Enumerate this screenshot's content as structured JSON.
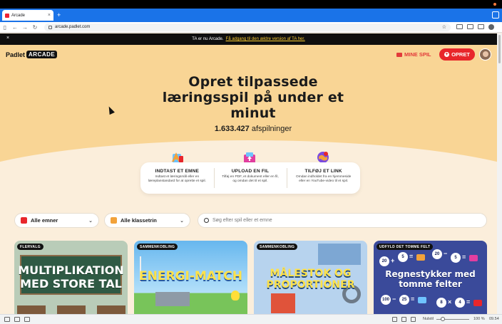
{
  "browser": {
    "tab_title": "Arcade",
    "tab_close": "×",
    "new_tab": "+",
    "url": "arcade.padlet.com",
    "bookmark": "☆"
  },
  "announcement": {
    "close": "×",
    "text": "TA er nu Arcade.",
    "link": "Få adgang til den ældre version af TA her."
  },
  "nav": {
    "logo_text": "Padlet",
    "logo_badge": "ARCADE",
    "my_games": "MINE SPIL",
    "create": "OPRET",
    "create_plus": "+"
  },
  "hero": {
    "title": "Opret tilpassede læringsspil på under et minut",
    "count_value": "1.633.427",
    "count_label": "afspilninger"
  },
  "steps": [
    {
      "title": "INDTAST ET EMNE",
      "desc": "Indtast et læringsmål eller en læreplanstandard for at oprette et spil."
    },
    {
      "title": "UPLOAD EN FIL",
      "desc": "Tilføj en PDF, et dokument eller en fil, og omdan det til et spil."
    },
    {
      "title": "TILFØJ ET LINK",
      "desc": "Omdan indholdet fra en hjemmeside eller en YouTube-video til et spil."
    }
  ],
  "filters": {
    "subjects": "Alle emner",
    "grades": "Alle klassetrin",
    "chevron": "⌄",
    "search_placeholder": "Søg efter spil eller et emne"
  },
  "cards": [
    {
      "tag": "FLERVALG",
      "title": "MULTIPLIKATION MED STORE TAL"
    },
    {
      "tag": "SAMMENKOBLING",
      "title": "ENERGI-MATCH"
    },
    {
      "tag": "SAMMENKOBLING",
      "title": "MÅLESTOK OG PROPORTIONER"
    },
    {
      "tag": "UDFYLD DET TOMME FELT",
      "title": "Regnestykker med tomme felter"
    }
  ],
  "card4_numbers": [
    "20",
    "5",
    "20",
    "5",
    "100",
    "25",
    "8",
    "4"
  ],
  "card4_symbols": [
    "+",
    "=",
    "−",
    "=",
    "−",
    "=",
    "×",
    "="
  ],
  "statusbar": {
    "reset": "Nulstil",
    "zoom": "100 %",
    "time": "09.54"
  },
  "colors": {
    "accent_red": "#e8262b",
    "hero_bg": "#f9d595",
    "page_bg": "#fbeedb",
    "tab_bar": "#1a73e8"
  }
}
